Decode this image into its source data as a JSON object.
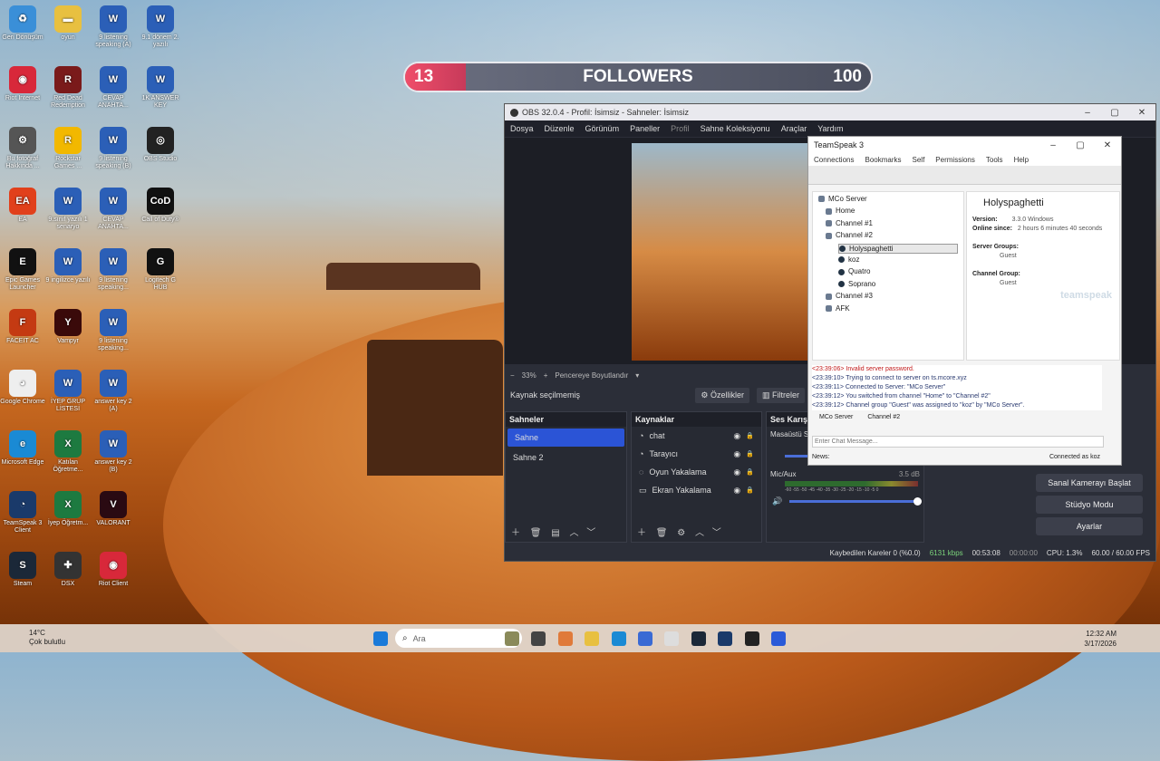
{
  "followers_widget": {
    "current": "13",
    "label": "FOLLOWERS",
    "goal": "100",
    "progress_fraction": 0.13
  },
  "desktop_icons": [
    {
      "label": "Geri Dönüşüm",
      "color": "#3a8fd8",
      "glyph": "♻"
    },
    {
      "label": "oyun",
      "color": "#e8c040",
      "glyph": "▬"
    },
    {
      "label": "9 listening speaking (A)",
      "color": "#2b5fb7",
      "glyph": "W"
    },
    {
      "label": "9.1 dönem 2. yazılı",
      "color": "#2b5fb7",
      "glyph": "W"
    },
    {
      "label": "Riot Internet",
      "color": "#d8283a",
      "glyph": "◉"
    },
    {
      "label": "Red Dead Redemption",
      "color": "#7a1a1a",
      "glyph": "R"
    },
    {
      "label": "CEVAP ANAHTA...",
      "color": "#2b5fb7",
      "glyph": "W"
    },
    {
      "label": "1K ANSWER KEY",
      "color": "#2b5fb7",
      "glyph": "W"
    },
    {
      "label": "Bu fotoğraf Hakkında ...",
      "color": "#555",
      "glyph": "⚙"
    },
    {
      "label": "Rockstar Games ...",
      "color": "#f2b800",
      "glyph": "R"
    },
    {
      "label": "9 listening speaking (B)",
      "color": "#2b5fb7",
      "glyph": "W"
    },
    {
      "label": "OBS Studio",
      "color": "#222",
      "glyph": "◎"
    },
    {
      "label": "EA",
      "color": "#e1401b",
      "glyph": "EA"
    },
    {
      "label": "9.sınıf yazılı 1 senaryo",
      "color": "#2b5fb7",
      "glyph": "W"
    },
    {
      "label": "CEVAP ANAHTA...",
      "color": "#2b5fb7",
      "glyph": "W"
    },
    {
      "label": "Call of Duty®",
      "color": "#111",
      "glyph": "CoD"
    },
    {
      "label": "Epic Games Launcher",
      "color": "#111",
      "glyph": "E"
    },
    {
      "label": "9 ingilizce yazılı",
      "color": "#2b5fb7",
      "glyph": "W"
    },
    {
      "label": "9 listening speaking...",
      "color": "#2b5fb7",
      "glyph": "W"
    },
    {
      "label": "Logitech G HUB",
      "color": "#111",
      "glyph": "G"
    },
    {
      "label": "FACEIT AC",
      "color": "#c43a12",
      "glyph": "F"
    },
    {
      "label": "Vampyr",
      "color": "#3a0a0a",
      "glyph": "Y"
    },
    {
      "label": "9 listening speaking...",
      "color": "#2b5fb7",
      "glyph": "W"
    },
    {
      "label": "",
      "color": "transparent",
      "glyph": ""
    },
    {
      "label": "Google Chrome",
      "color": "#eee",
      "glyph": "◕"
    },
    {
      "label": "İYEP GRUP LİSTESİ",
      "color": "#2b5fb7",
      "glyph": "W"
    },
    {
      "label": "answer key 2 (A)",
      "color": "#2b5fb7",
      "glyph": "W"
    },
    {
      "label": "",
      "color": "transparent",
      "glyph": ""
    },
    {
      "label": "Microsoft Edge",
      "color": "#1a8ad4",
      "glyph": "e"
    },
    {
      "label": "Katılan Öğretme...",
      "color": "#1d7a40",
      "glyph": "X"
    },
    {
      "label": "answer key 2 (B)",
      "color": "#2b5fb7",
      "glyph": "W"
    },
    {
      "label": "",
      "color": "transparent",
      "glyph": ""
    },
    {
      "label": "TeamSpeak 3 Client",
      "color": "#1a3a6a",
      "glyph": "◔"
    },
    {
      "label": "İyep Öğretm...",
      "color": "#1d7a40",
      "glyph": "X"
    },
    {
      "label": "VALORANT",
      "color": "#2a0a12",
      "glyph": "V"
    },
    {
      "label": "",
      "color": "transparent",
      "glyph": ""
    },
    {
      "label": "Steam",
      "color": "#1b2838",
      "glyph": "S"
    },
    {
      "label": "DSX",
      "color": "#333",
      "glyph": "✚"
    },
    {
      "label": "Riot Client",
      "color": "#d8283a",
      "glyph": "◉"
    }
  ],
  "obs": {
    "title": "OBS 32.0.4 - Profil: İsimsiz - Sahneler: İsimsiz",
    "menu": [
      "Dosya",
      "Düzenle",
      "Görünüm",
      "Paneller",
      "Profil",
      "Sahne Koleksiyonu",
      "Araçlar",
      "Yardım"
    ],
    "zoom": "33%",
    "fit_label": "Pencereye Boyutlandır",
    "no_source": "Kaynak seçilmemiş",
    "properties": "Özellikler",
    "filters": "Filtreler",
    "scenes_title": "Sahneler",
    "scenes": [
      "Sahne",
      "Sahne 2"
    ],
    "sources_title": "Kaynaklar",
    "sources": [
      "chat",
      "Tarayıcı",
      "Oyun Yakalama",
      "Ekran Yakalama"
    ],
    "mixer_title": "Ses Karıştırıcı",
    "mixer_desktop": "Masaüstü Se",
    "mixer_mic": "Mic/Aux",
    "mic_db": "3.5 dB",
    "vu_ticks": "-60 -55 -50 -45 -40 -35 -30 -25 -20 -15 -10 -5 0",
    "virtual_cam": "Sanal Kamerayı Başlat",
    "studio_mode": "Stüdyo Modu",
    "settings": "Ayarlar",
    "status": {
      "dropped": "Kaybedilen Kareler 0 (%0.0)",
      "bitrate": "6131 kbps",
      "stream_time": "00:53:08",
      "rec_time": "00:00:00",
      "cpu": "CPU: 1.3%",
      "fps": "60.00 / 60.00 FPS"
    }
  },
  "teamspeak": {
    "title": "TeamSpeak 3",
    "menu": [
      "Connections",
      "Bookmarks",
      "Self",
      "Permissions",
      "Tools",
      "Help"
    ],
    "server": "MCo Server",
    "channels": [
      "Home",
      "Channel #1",
      "Channel #2",
      "Channel #3",
      "AFK"
    ],
    "users": [
      "Holyspaghetti",
      "koz",
      "Quatro",
      "Soprano"
    ],
    "info": {
      "name": "Holyspaghetti",
      "version_label": "Version:",
      "version": "3.3.0 Windows",
      "online_label": "Online since:",
      "online": "2 hours 6 minutes 40 seconds",
      "server_groups_label": "Server Groups:",
      "server_group": "Guest",
      "channel_group_label": "Channel Group:",
      "channel_group": "Guest",
      "brand": "teamspeak"
    },
    "log": [
      "<23:39:06> Invalid server password.",
      "<23:39:10> Trying to connect to server on ts.mcore.xyz",
      "<23:39:11> Connected to Server: \"MCo Server\"",
      "<23:39:12> You switched from channel \"Home\" to \"Channel #2\"",
      "<23:39:12> Channel group \"Guest\" was assigned to \"koz\" by \"MCo Server\"."
    ],
    "tabs": [
      "MCo Server",
      "Channel #2"
    ],
    "chat_placeholder": "Enter Chat Message...",
    "news_label": "News:",
    "connected_as": "Connected as koz"
  },
  "taskbar": {
    "weather_temp": "14°C",
    "weather_desc": "Çok bulutlu",
    "search_placeholder": "Ara",
    "time": "12:32 AM",
    "date": "3/17/2026"
  }
}
